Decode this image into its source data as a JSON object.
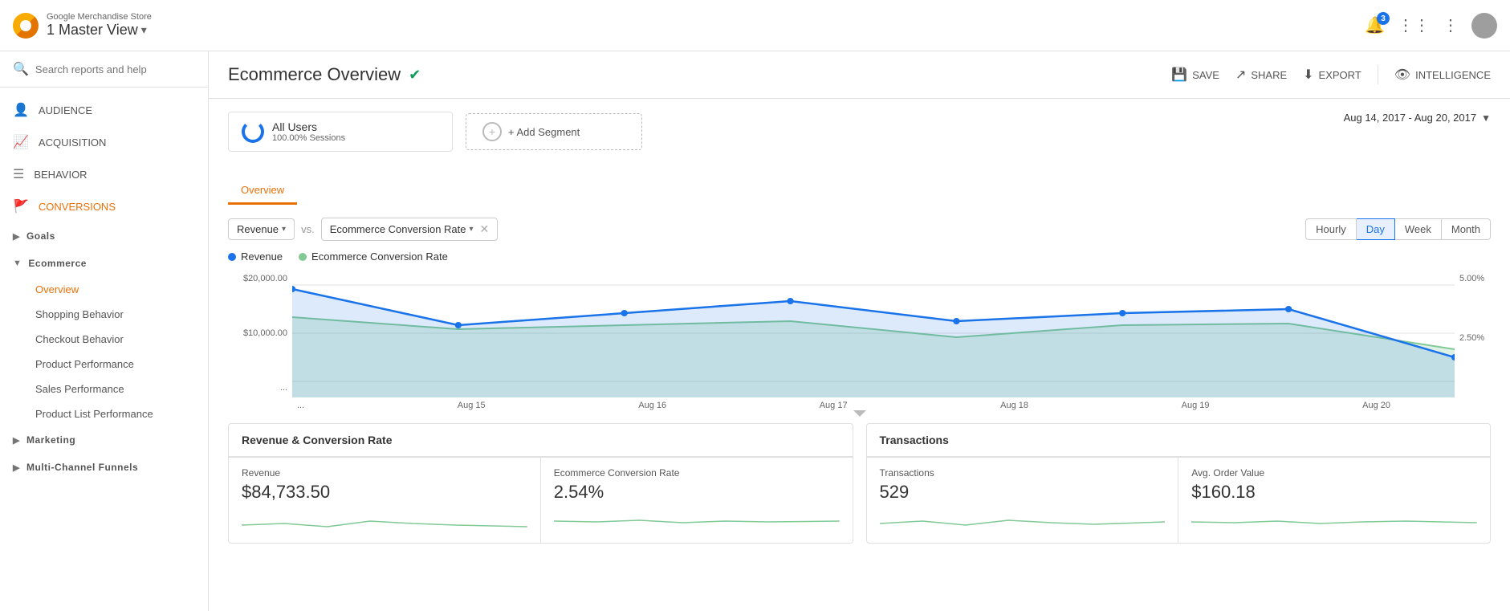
{
  "topbar": {
    "account_name": "Google Merchandise Store",
    "view_label": "1 Master View",
    "dropdown_icon": "▾",
    "notification_count": "3",
    "apps_icon": "⋮⋮⋮",
    "more_icon": "⋮"
  },
  "sidebar": {
    "search_placeholder": "Search reports and help",
    "nav_items": [
      {
        "id": "audience",
        "label": "AUDIENCE",
        "icon": "👤"
      },
      {
        "id": "acquisition",
        "label": "ACQUISITION",
        "icon": "📈"
      },
      {
        "id": "behavior",
        "label": "BEHAVIOR",
        "icon": "☰"
      },
      {
        "id": "conversions",
        "label": "CONVERSIONS",
        "icon": "🚩"
      }
    ],
    "ecommerce_section": {
      "header": "Ecommerce",
      "items": [
        {
          "id": "overview",
          "label": "Overview",
          "active": true
        },
        {
          "id": "shopping-behavior",
          "label": "Shopping Behavior"
        },
        {
          "id": "checkout-behavior",
          "label": "Checkout Behavior"
        },
        {
          "id": "product-performance",
          "label": "Product Performance"
        },
        {
          "id": "sales-performance",
          "label": "Sales Performance"
        },
        {
          "id": "product-list-performance",
          "label": "Product List Performance"
        }
      ]
    },
    "extra_sections": [
      {
        "id": "marketing",
        "label": "Marketing"
      },
      {
        "id": "multi-channel",
        "label": "Multi-Channel Funnels"
      }
    ],
    "goals_label": "Goals"
  },
  "header": {
    "title": "Ecommerce Overview",
    "verified": true,
    "actions": {
      "save": "SAVE",
      "share": "SHARE",
      "export": "EXPORT",
      "intelligence": "INTELLIGENCE"
    }
  },
  "date_range": "Aug 14, 2017 - Aug 20, 2017",
  "segments": {
    "all_users": {
      "name": "All Users",
      "detail": "100.00% Sessions"
    },
    "add_segment_label": "+ Add Segment"
  },
  "overview_tab": "Overview",
  "chart": {
    "metric1": {
      "label": "Revenue",
      "dropdown": true
    },
    "vs": "vs.",
    "metric2": {
      "label": "Ecommerce Conversion Rate",
      "dropdown": true
    },
    "time_buttons": [
      "Hourly",
      "Day",
      "Week",
      "Month"
    ],
    "active_time": "Day",
    "legend": {
      "revenue": "Revenue",
      "conversion": "Ecommerce Conversion Rate"
    },
    "y_labels_left": [
      "$20,000.00",
      "$10,000.00",
      "..."
    ],
    "y_labels_right": [
      "5.00%",
      "2.50%"
    ],
    "x_labels": [
      "...",
      "Aug 15",
      "Aug 16",
      "Aug 17",
      "Aug 18",
      "Aug 19",
      "Aug 20"
    ]
  },
  "stats": {
    "group1": {
      "header": "Revenue & Conversion Rate",
      "cards": [
        {
          "label": "Revenue",
          "value": "$84,733.50"
        },
        {
          "label": "Ecommerce Conversion Rate",
          "value": "2.54%"
        }
      ]
    },
    "group2": {
      "header": "Transactions",
      "cards": [
        {
          "label": "Transactions",
          "value": "529"
        },
        {
          "label": "Avg. Order Value",
          "value": "$160.18"
        }
      ]
    }
  }
}
